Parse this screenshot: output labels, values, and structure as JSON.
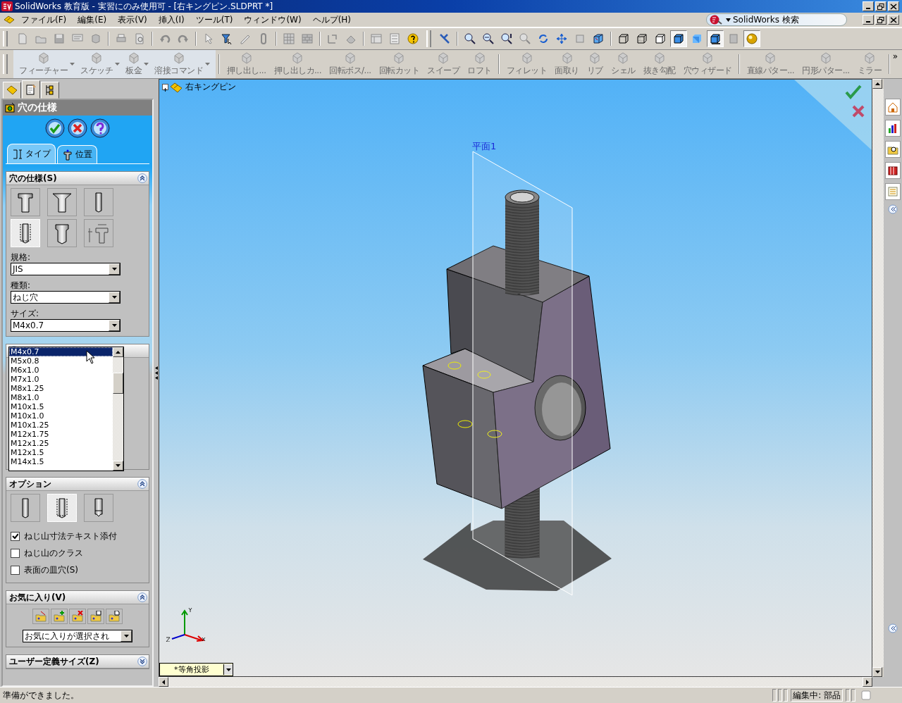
{
  "window": {
    "title": "SolidWorks 教育版 - 実習にのみ使用可 - [右キングピン.SLDPRT *]"
  },
  "menu_bar": {
    "items": [
      "ファイル(F)",
      "編集(E)",
      "表示(V)",
      "挿入(I)",
      "ツール(T)",
      "ウィンドウ(W)",
      "ヘルプ(H)"
    ]
  },
  "search": {
    "placeholder": "SolidWorks 検索"
  },
  "display_modes": [
    {
      "selected": false
    },
    {
      "selected": false
    },
    {
      "selected": false
    },
    {
      "selected": true
    },
    {
      "selected": false
    },
    {
      "selected": true
    },
    {
      "selected": false
    },
    {
      "selected": true
    }
  ],
  "command_manager": {
    "tabs": [
      "フィーチャー",
      "スケッチ",
      "板金",
      "溶接コマンド"
    ],
    "commands": [
      "押し出し...",
      "押し出しカ...",
      "回転ボス/...",
      "回転カット",
      "スイープ",
      "ロフト",
      "フィレット",
      "面取り",
      "リブ",
      "シェル",
      "抜き勾配",
      "穴ウィザード",
      "直線パター...",
      "円形パター...",
      "ミラー"
    ],
    "more": "»"
  },
  "property_manager": {
    "title": "穴の仕様",
    "tabs": [
      {
        "label": "タイプ",
        "selected": true
      },
      {
        "label": "位置",
        "selected": false
      }
    ],
    "hole_spec": {
      "title": "穴の仕様(S)",
      "types": [
        {
          "selected": false
        },
        {
          "selected": false
        },
        {
          "selected": false
        },
        {
          "selected": true
        },
        {
          "selected": false
        },
        {
          "selected": false
        }
      ],
      "fields": [
        {
          "label": "規格:",
          "value": "JIS"
        },
        {
          "label": "種類:",
          "value": "ねじ穴"
        },
        {
          "label": "サイズ:",
          "value": "M4x0.7"
        }
      ]
    },
    "size_list": [
      {
        "label": "M4x0.7",
        "selected": true
      },
      {
        "label": "M5x0.8",
        "selected": false
      },
      {
        "label": "M6x1.0",
        "selected": false
      },
      {
        "label": "M7x1.0",
        "selected": false
      },
      {
        "label": "M8x1.25",
        "selected": false
      },
      {
        "label": "M8x1.0",
        "selected": false
      },
      {
        "label": "M10x1.5",
        "selected": false
      },
      {
        "label": "M10x1.0",
        "selected": false
      },
      {
        "label": "M10x1.25",
        "selected": false
      },
      {
        "label": "M12x1.75",
        "selected": false
      },
      {
        "label": "M12x1.25",
        "selected": false
      },
      {
        "label": "M12x1.5",
        "selected": false
      },
      {
        "label": "M14x1.5",
        "selected": false
      }
    ],
    "options": {
      "title": "オプション",
      "types": [
        {
          "selected": false
        },
        {
          "selected": true
        },
        {
          "selected": false
        }
      ],
      "checkboxes": [
        {
          "label": "ねじ山寸法テキスト添付",
          "checked": true
        },
        {
          "label": "ねじ山のクラス",
          "checked": false
        },
        {
          "label": "表面の皿穴(S)",
          "checked": false
        }
      ]
    },
    "favorites": {
      "title": "お気に入り(V)",
      "value": "お気に入りが選択され"
    },
    "custom_size": {
      "title": "ユーザー定義サイズ(Z)",
      "expanded": false
    }
  },
  "viewport": {
    "tree_root": "右キングピン",
    "plane_label": "平面1",
    "view_orientation": "*等角投影"
  },
  "status_bar": {
    "message": "準備ができました。",
    "mode": "編集中: 部品"
  }
}
